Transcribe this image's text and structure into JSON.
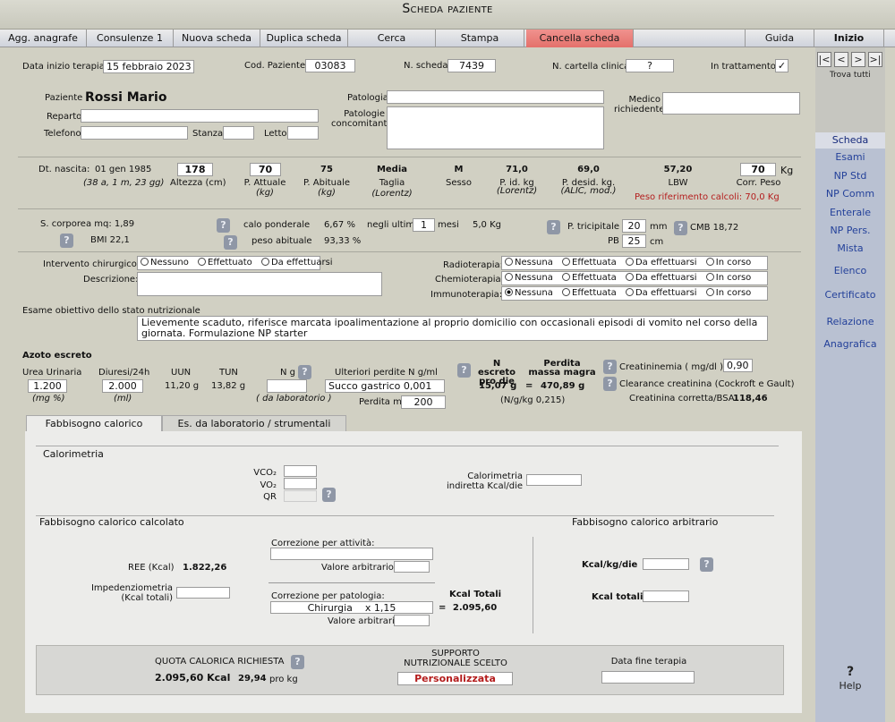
{
  "window_title": "Scheda paziente",
  "toolbar": {
    "items": [
      "Agg. anagrafe",
      "Consulenze 1",
      "Nuova scheda",
      "Duplica scheda",
      "Cerca",
      "Stampa",
      "Cancella scheda",
      "",
      "Guida",
      "Inizio"
    ]
  },
  "sidebar": {
    "nav": {
      "first": "|<",
      "prev": "<",
      "next": ">",
      "last": ">|"
    },
    "find_all": "Trova tutti",
    "items": [
      "Scheda",
      "Esami",
      "NP Std",
      "NP Comm",
      "Enterale",
      "NP Pers.",
      "Mista",
      "Elenco",
      "Certificato",
      "Relazione",
      "Anagrafica"
    ],
    "help_q": "?",
    "help_label": "Help"
  },
  "header": {
    "start_date_label": "Data inizio terapia",
    "start_date": "15 febbraio 2023",
    "patient_code_label": "Cod. Paziente",
    "patient_code": "03083",
    "sheet_no_label": "N. scheda",
    "sheet_no": "7439",
    "record_no_label": "N. cartella clinica",
    "record_no": "?",
    "in_treatment_label": "In trattamento",
    "in_treatment_mark": "✓"
  },
  "patient": {
    "name_label": "Paziente",
    "name": "Rossi Mario",
    "ward_label": "Reparto",
    "phone_label": "Telefono",
    "room_label": "Stanza",
    "bed_label": "Letto",
    "pathology_label": "Patologia",
    "concomitant_label": "Patologie concomitanti",
    "doctor_label": "Medico richiedente"
  },
  "anthro": {
    "birth_label": "Dt. nascita:",
    "birth_date": "01 gen 1985",
    "age": "(38 a, 1 m, 23 gg)",
    "height": "178",
    "height_label": "Altezza (cm)",
    "current_weight": "70",
    "current_weight_label": "P. Attuale",
    "current_weight_unit": "(kg)",
    "usual_weight": "75",
    "usual_weight_label": "P. Abituale",
    "usual_weight_unit": "(kg)",
    "size": "Media",
    "size_label": "Taglia",
    "size_sub": "(Lorentz)",
    "sex": "M",
    "sex_label": "Sesso",
    "ideal_weight": "71,0",
    "ideal_weight_label": "P. id. kg",
    "ideal_weight_sub": "(Lorentz)",
    "desired_weight": "69,0",
    "desired_weight_label": "P. desid. kg.",
    "desired_weight_sub": "(ALIC, mod.)",
    "lbw": "57,20",
    "lbw_label": "LBW",
    "corr_weight": "70",
    "corr_weight_label": "Corr. Peso",
    "kg": "Kg",
    "reference_weight": "Peso riferimento calcoli: 70,0 Kg"
  },
  "body": {
    "bsa": "S. corporea mq: 1,89",
    "bmi": "BMI 22,1",
    "weight_loss_label": "calo ponderale",
    "weight_loss_pct": "6,67 %",
    "last_label": "negli ultimi",
    "months_value": "1",
    "months_label": "mesi",
    "weight_loss_kg": "5,0 Kg",
    "usual_weight_label": "peso abituale",
    "usual_weight_pct": "93,33 %",
    "triceps_label": "P. tricipitale",
    "triceps_value": "20",
    "triceps_unit": "mm",
    "cmb": "CMB 18,72",
    "pb_label": "PB",
    "pb_value": "25",
    "pb_unit": "cm"
  },
  "therapy": {
    "surgery_label": "Intervento chirurgico:",
    "surgery_options": [
      "Nessuno",
      "Effettuato",
      "Da effettuarsi"
    ],
    "description_label": "Descrizione:",
    "radio_label": "Radioterapia:",
    "chemo_label": "Chemioterapia:",
    "immuno_label": "Immunoterapia:",
    "therapy_options": [
      "Nessuna",
      "Effettuata",
      "Da effettuarsi",
      "In corso"
    ]
  },
  "exam": {
    "label": "Esame obiettivo dello stato nutrizionale",
    "text": "Lievemente scaduto, riferisce marcata ipoalimentazione al proprio domicilio con occasionali episodi di vomito nel corso della giornata. Formulazione NP starter"
  },
  "nitrogen": {
    "title": "Azoto escreto",
    "urea_label": "Urea Urinaria",
    "urea_value": "1.200",
    "urea_unit": "(mg %)",
    "diuresis_label": "Diuresi/24h",
    "diuresis_value": "2.000",
    "diuresis_unit": "(ml)",
    "uun_label": "UUN",
    "uun_value": "11,20 g",
    "tun_label": "TUN",
    "tun_value": "13,82 g",
    "ng_label": "N g",
    "ng_unit": "( da laboratorio )",
    "losses_label": "Ulteriori  perdite N g/ml",
    "losses_source": "Succo gastrico",
    "losses_value": "0,001",
    "loss_ml_label": "Perdita ml",
    "loss_ml_value": "200",
    "excreted_label": "N escreto pro die",
    "excreted_value": "15,07 g",
    "equals": "=",
    "lean_loss_label": "Perdita massa magra",
    "lean_loss_value": "470,89 g",
    "n_per_kg": "(N/g/kg 0,215)",
    "creatinine_label": "Creatininemia  ( mg/dl )",
    "creatinine_value": "0,90",
    "clearance_label": "Clearance creatinina  (Cockroft e Gault)",
    "corrected_label": "Creatinina corretta/BSA",
    "corrected_value": "118,46"
  },
  "lower_tabs": [
    "Fabbisogno calorico",
    "Es. da laboratorio / strumentali"
  ],
  "calorimetry": {
    "title": "Calorimetria",
    "vco2": "VCO₂",
    "vo2": "VO₂",
    "qr": "QR",
    "indirect_label": "Calorimetria indiretta Kcal/die"
  },
  "calculated": {
    "title": "Fabbisogno calorico calcolato",
    "ree_label": "REE (Kcal)",
    "ree_value": "1.822,26",
    "imped_label": "Impedenziometria (Kcal totali)",
    "activity_label": "Correzione per attività:",
    "arbitrary_label": "Valore arbitrario:",
    "pathology_corr_label": "Correzione per patologia:",
    "pathology_corr_value": "Chirurgia    x 1,15",
    "arbitrary2_label": "Valore arbitrario:",
    "kcal_total_label": "Kcal Totali",
    "kcal_total_value": "= 2.095,60"
  },
  "arbitrary": {
    "title": "Fabbisogno calorico arbitrario",
    "kcal_kg_label": "Kcal/kg/die",
    "kcal_total_label": "Kcal totali"
  },
  "summary": {
    "quota_label": "QUOTA CALORICA RICHIESTA",
    "quota_value": "2.095,60 Kcal",
    "per_kg": "29,94",
    "per_kg_unit": "pro kg",
    "support_label": "SUPPORTO NUTRIZIONALE SCELTO",
    "support_value": "Personalizzata",
    "end_label": "Data fine terapia"
  },
  "colors": {
    "danger_tab": "#e4706b",
    "accent_red": "#b41d1d",
    "link_blue": "#24419a",
    "sidebar": "#b9c1d2"
  }
}
